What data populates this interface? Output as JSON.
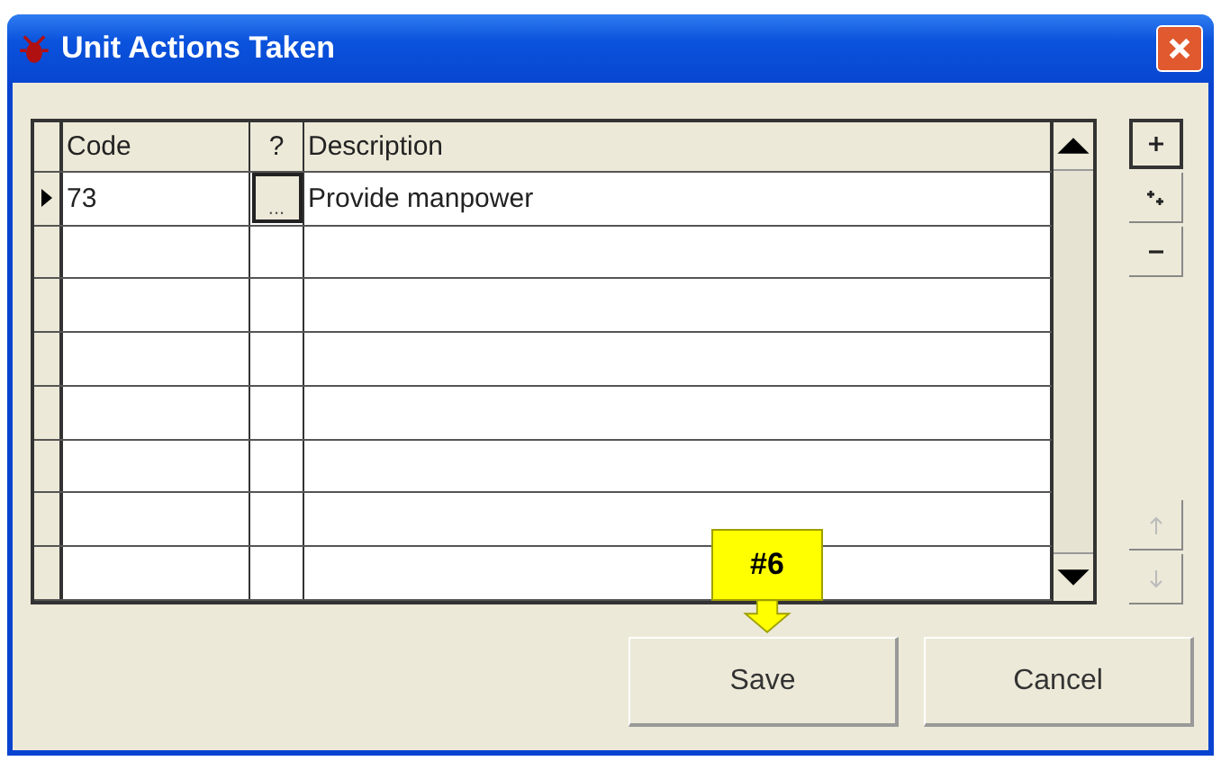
{
  "window": {
    "title": "Unit Actions Taken"
  },
  "table": {
    "columns": [
      "Code",
      "?",
      "Description"
    ],
    "rows": [
      {
        "current": true,
        "code": "73",
        "lookup": "...",
        "description": "Provide manpower"
      },
      {
        "current": false
      },
      {
        "current": false
      },
      {
        "current": false
      },
      {
        "current": false
      },
      {
        "current": false
      },
      {
        "current": false
      },
      {
        "current": false
      }
    ]
  },
  "side_buttons": [
    {
      "kind": "add",
      "disabled": false
    },
    {
      "kind": "add_many",
      "disabled": false
    },
    {
      "kind": "remove",
      "disabled": false
    },
    {
      "kind": "up",
      "disabled": true
    },
    {
      "kind": "down",
      "disabled": true
    }
  ],
  "callout": {
    "text": "#6"
  },
  "buttons": [
    "Save",
    "Cancel"
  ]
}
